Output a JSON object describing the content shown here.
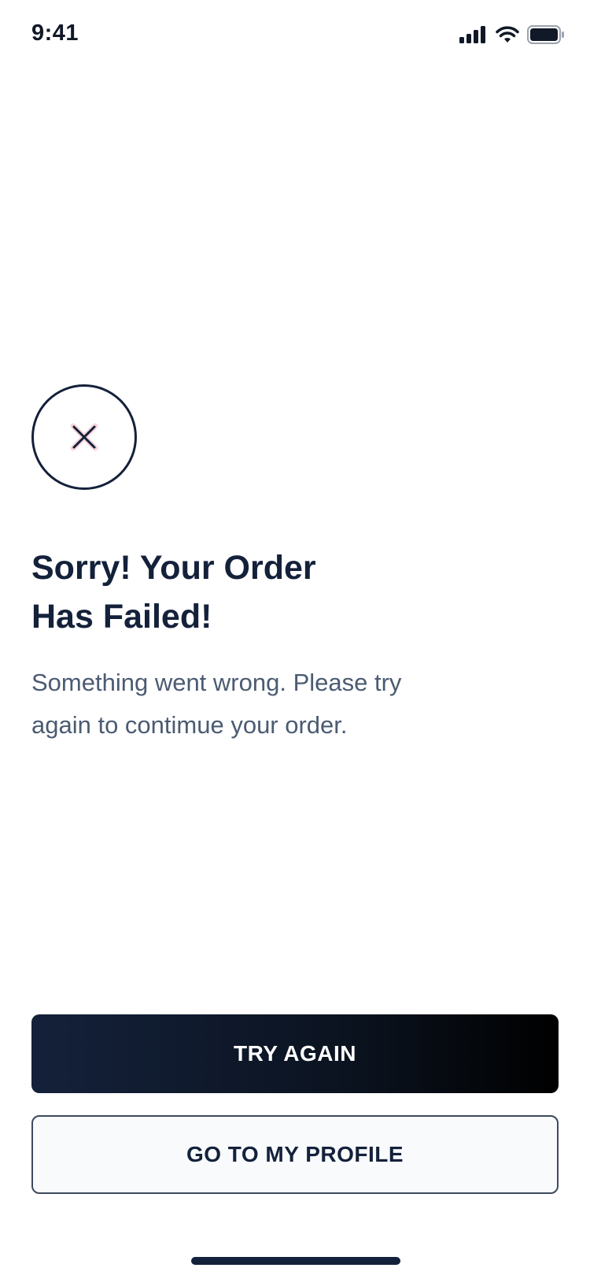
{
  "status_bar": {
    "time": "9:41",
    "icons": [
      "cellular-signal-icon",
      "wifi-icon",
      "battery-icon"
    ]
  },
  "status_icon": {
    "name": "close-icon",
    "accent": "#e5455c"
  },
  "title": "Sorry! Your Order\nHas Failed!",
  "message": "Something went wrong. Please try\nagain to contimue your order.",
  "actions": {
    "primary_label": "TRY AGAIN",
    "secondary_label": "GO TO MY PROFILE"
  },
  "colors": {
    "text_dark": "#14213a",
    "text_muted": "#4b5b72",
    "button_primary_bg": "#0b1320",
    "button_secondary_bg": "#f8fafc"
  }
}
